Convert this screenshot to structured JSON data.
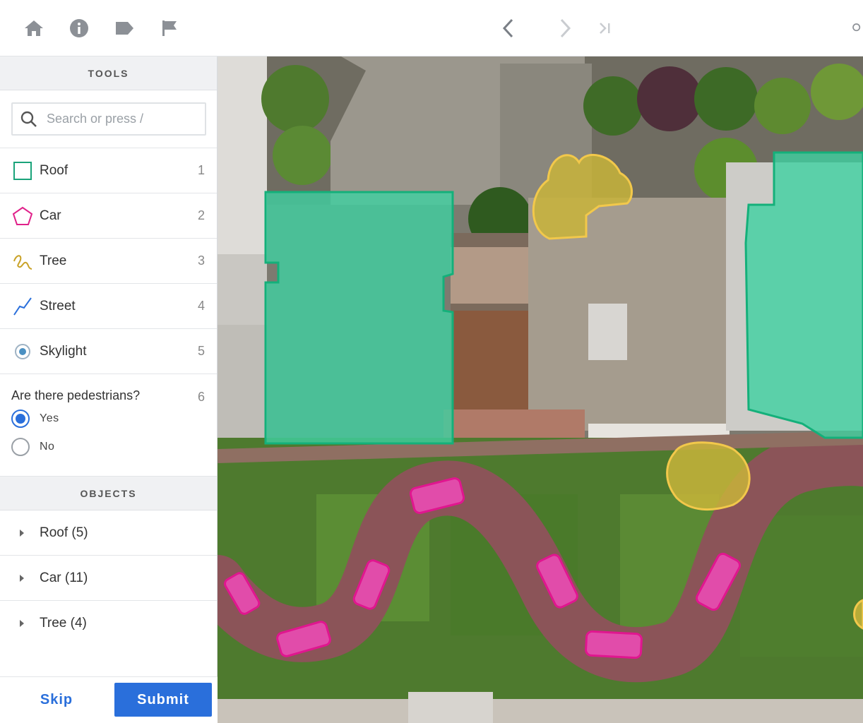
{
  "toolbar": {
    "icons": [
      "home-icon",
      "info-icon",
      "tag-icon",
      "flag-icon"
    ],
    "nav": [
      "chevron-left-icon",
      "chevron-right-icon",
      "skip-to-end-icon",
      "search-icon"
    ]
  },
  "sidebar": {
    "tools_header": "TOOLS",
    "search": {
      "placeholder": "Search or press /"
    },
    "tools": [
      {
        "label": "Roof",
        "key": "1",
        "icon": "bounding-box-icon",
        "color": "#1aa37a"
      },
      {
        "label": "Car",
        "key": "2",
        "icon": "polygon-icon",
        "color": "#e0218a"
      },
      {
        "label": "Tree",
        "key": "3",
        "icon": "freehand-icon",
        "color": "#c9a227"
      },
      {
        "label": "Street",
        "key": "4",
        "icon": "polyline-icon",
        "color": "#2a6fdb"
      },
      {
        "label": "Skylight",
        "key": "5",
        "icon": "point-icon",
        "color": "#4a90c2"
      }
    ],
    "question": {
      "text": "Are there pedestrians?",
      "key": "6",
      "options": [
        {
          "label": "Yes",
          "checked": true
        },
        {
          "label": "No",
          "checked": false
        }
      ]
    },
    "objects_header": "OBJECTS",
    "objects": [
      {
        "label": "Roof (5)"
      },
      {
        "label": "Car (11)"
      },
      {
        "label": "Tree (4)"
      }
    ],
    "skip_label": "Skip",
    "submit_label": "Submit"
  },
  "colors": {
    "accent": "#2a6fdb",
    "roof_fill": "#3fd1a1",
    "roof_stroke": "#14b07a",
    "car_fill": "#f04bb8",
    "car_stroke": "#e0168f",
    "tree_fill": "#c8b43a",
    "tree_stroke": "#f2c84b"
  }
}
